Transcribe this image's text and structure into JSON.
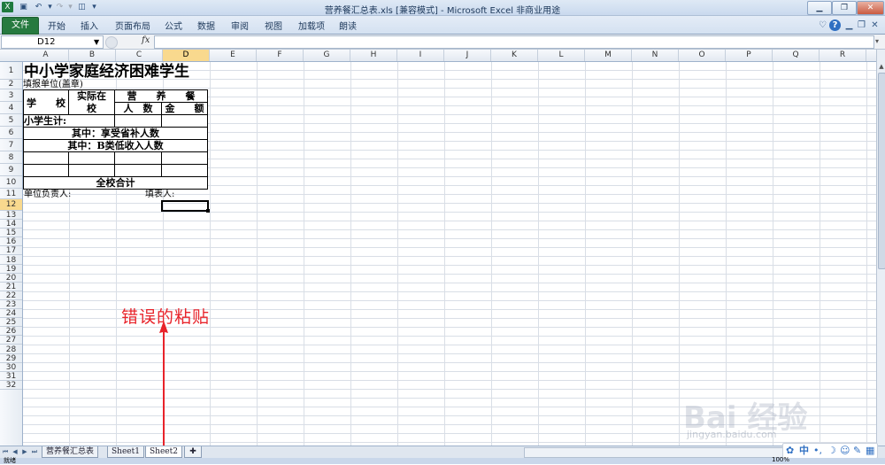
{
  "window": {
    "title": "营养餐汇总表.xls  [兼容模式] - Microsoft Excel 非商业用途",
    "quick_access": [
      "excel-logo-icon",
      "save-icon",
      "undo-icon",
      "redo-icon",
      "print-preview-icon"
    ]
  },
  "ribbon": {
    "file_tab": "文件",
    "tabs": [
      "开始",
      "插入",
      "页面布局",
      "公式",
      "数据",
      "审阅",
      "视图",
      "加载项",
      "朗读"
    ]
  },
  "formula_bar": {
    "name_box": "D12",
    "fx_label": "fx",
    "value": ""
  },
  "columns": [
    "A",
    "B",
    "C",
    "D",
    "E",
    "F",
    "G",
    "H",
    "I",
    "J",
    "K",
    "L",
    "M",
    "N",
    "O",
    "P",
    "Q",
    "R"
  ],
  "selected_column": "D",
  "rows": [
    "1",
    "2",
    "3",
    "4",
    "5",
    "6",
    "7",
    "8",
    "9",
    "10",
    "11",
    "12",
    "13",
    "14",
    "15",
    "16",
    "17",
    "18",
    "19",
    "20",
    "21",
    "22",
    "23",
    "24",
    "25",
    "26",
    "27",
    "28",
    "29",
    "30",
    "31",
    "32"
  ],
  "selected_row": "12",
  "sheet_content": {
    "r1_title": "中小学家庭经济困难学生",
    "r2_unit": "填报单位(盖章)",
    "r3_school": "学　　校",
    "r3_actual": "实际在",
    "r3_actual2": "校",
    "r3_meal": "营　　养　　餐",
    "r4_count": "人　数",
    "r4_amount": "金　　额",
    "r5_subtotal": "小学生计:",
    "r6_subsidy": "其中：享受省补人数",
    "r7_typeb": "其中：B类低收入人数",
    "r10_total": "全校合计",
    "r11_head": "单位负责人:",
    "r11_filler": "填表人:"
  },
  "annotation": "错误的粘贴",
  "annotation_color": "#e8232a",
  "sheet_tabs": [
    "营养餐汇总表",
    "Sheet1",
    "Sheet2"
  ],
  "active_sheet": "Sheet2",
  "status": {
    "ready": "就绪",
    "zoom": "100%"
  },
  "watermark": {
    "logo": "Bai 经验",
    "url": "jingyan.baidu.com"
  },
  "ime": "中"
}
